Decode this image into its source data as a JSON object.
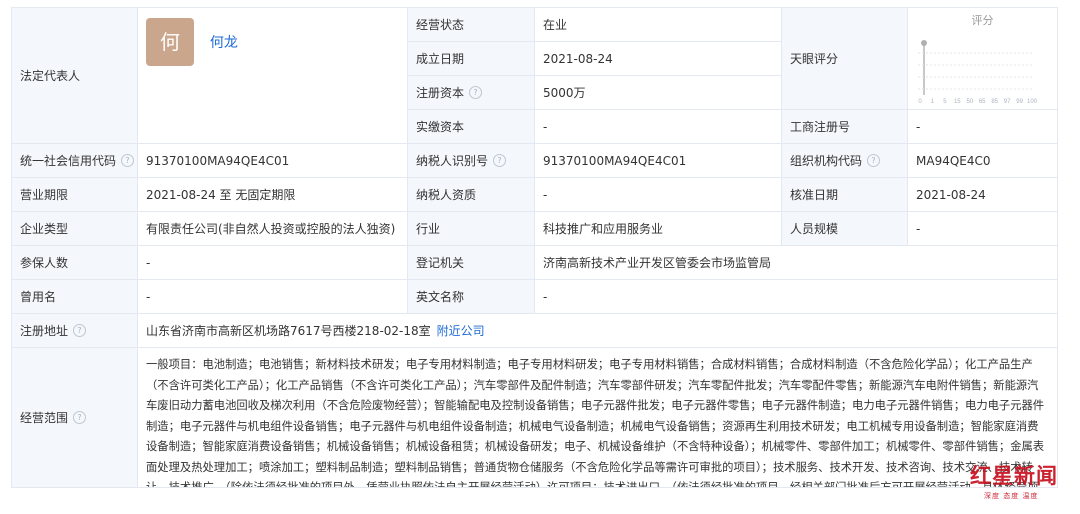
{
  "legal_rep": {
    "label": "法定代表人",
    "avatar_char": "何",
    "name": "何龙"
  },
  "status": {
    "label": "经营状态",
    "value": "在业"
  },
  "established": {
    "label": "成立日期",
    "value": "2021-08-24"
  },
  "reg_capital": {
    "label": "注册资本",
    "value": "5000万"
  },
  "paid_capital": {
    "label": "实缴资本",
    "value": "-"
  },
  "tianyan": {
    "label": "天眼评分",
    "score_title": "评分",
    "ticks": [
      "0",
      "1",
      "5",
      "15",
      "50",
      "65",
      "85",
      "97",
      "99",
      "100"
    ]
  },
  "icbn": {
    "label": "工商注册号",
    "value": "-"
  },
  "credit_code": {
    "label": "统一社会信用代码",
    "value": "91370100MA94QE4C01"
  },
  "taxpayer_id": {
    "label": "纳税人识别号",
    "value": "91370100MA94QE4C01"
  },
  "org_code": {
    "label": "组织机构代码",
    "value": "MA94QE4C0"
  },
  "term": {
    "label": "营业期限",
    "value": "2021-08-24 至 无固定期限"
  },
  "taxpayer_qual": {
    "label": "纳税人资质",
    "value": "-"
  },
  "approve_date": {
    "label": "核准日期",
    "value": "2021-08-24"
  },
  "company_type": {
    "label": "企业类型",
    "value": "有限责任公司(非自然人投资或控股的法人独资)"
  },
  "industry": {
    "label": "行业",
    "value": "科技推广和应用服务业"
  },
  "staff_size": {
    "label": "人员规模",
    "value": "-"
  },
  "insured": {
    "label": "参保人数",
    "value": "-"
  },
  "authority": {
    "label": "登记机关",
    "value": "济南高新技术产业开发区管委会市场监管局"
  },
  "former_name": {
    "label": "曾用名",
    "value": "-"
  },
  "english_name": {
    "label": "英文名称",
    "value": "-"
  },
  "address": {
    "label": "注册地址",
    "value": "山东省济南市高新区机场路7617号西楼218-02-18室",
    "link": "附近公司"
  },
  "scope": {
    "label": "经营范围",
    "text": "一般项目：电池制造；电池销售；新材料技术研发；电子专用材料制造；电子专用材料研发；电子专用材料销售；合成材料销售；合成材料制造（不含危险化学品）；化工产品生产（不含许可类化工产品）；化工产品销售（不含许可类化工产品）；汽车零部件及配件制造；汽车零部件研发；汽车零配件批发；汽车零配件零售；新能源汽车电附件销售；新能源汽车废旧动力蓄电池回收及梯次利用（不含危险废物经营）；智能输配电及控制设备销售；电子元器件批发；电子元器件零售；电子元器件制造；电力电子元器件销售；电力电子元器件制造；电子元器件与机电组件设备销售；电子元器件与机电组件设备制造；机械电气设备制造；机械电气设备销售；资源再生利用技术研发；电工机械专用设备制造；智能家庭消费设备制造；智能家庭消费设备销售；机械设备销售；机械设备租赁；机械设备研发；电子、机械设备维护（不含特种设备）；机械零件、零部件加工；机械零件、零部件销售；金属表面处理及热处理加工；喷涂加工；塑料制品制造；塑料制品销售；普通货物仓储服务（不含危险化学品等需许可审批的项目）；技术服务、技术开发、技术咨询、技术交流、技术转让、技术推广。（除依法须经批准的项目外，凭营业执照依法自主开展经营活动）许可项目：技术进出口。（依法须经批准的项目，经相关部门批准后方可开展经营活动，具体经营项目以相关部门批准文件或许可证件为准）"
  },
  "watermark": {
    "main": "红星新闻",
    "sub": "深度 态度 温度"
  }
}
